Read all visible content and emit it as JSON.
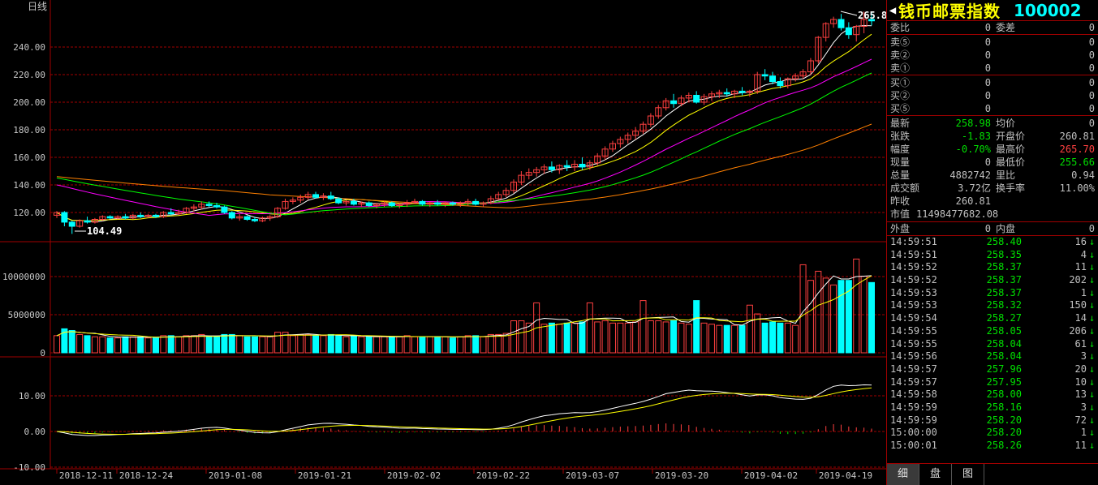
{
  "period_label": "日线",
  "price_axis": [
    "240.00",
    "220.00",
    "200.00",
    "180.00",
    "160.00",
    "140.00",
    "120.00"
  ],
  "volume_axis": [
    "10000000",
    "5000000",
    "0"
  ],
  "macd_axis": [
    "10.00",
    "0.00",
    "-10.00"
  ],
  "dates": [
    "2018-12-11",
    "2018-12-24",
    "2019-01-08",
    "2019-01-21",
    "2019-02-02",
    "2019-02-22",
    "2019-03-07",
    "2019-03-20",
    "2019-04-02",
    "2019-04-19"
  ],
  "high_marker": "265.8",
  "low_marker": "104.49",
  "colors": {
    "up": "#ff4040",
    "down": "#00ffff",
    "grid": "#a00000",
    "ma5": "#ffffff",
    "ma10": "#ffff00",
    "ma20": "#ff00ff",
    "ma30": "#00ff00",
    "ma60": "#ff8000"
  },
  "header": {
    "name": "钱币邮票指数",
    "code": "100002"
  },
  "orderbook": {
    "weibi_label": "委比",
    "weibi": "0",
    "weicha_label": "委差",
    "weicha": "0",
    "asks": [
      {
        "label": "卖⑤",
        "price": "0",
        "vol": "0"
      },
      {
        "label": "卖②",
        "price": "0",
        "vol": "0"
      },
      {
        "label": "卖①",
        "price": "0",
        "vol": "0"
      }
    ],
    "bids": [
      {
        "label": "买①",
        "price": "0",
        "vol": "0"
      },
      {
        "label": "买②",
        "price": "0",
        "vol": "0"
      },
      {
        "label": "买⑤",
        "price": "0",
        "vol": "0"
      }
    ]
  },
  "stats": {
    "latest_label": "最新",
    "latest": "258.98",
    "avg_label": "均价",
    "avg": "0",
    "change_label": "张跌",
    "change": "-1.83",
    "open_label": "开盘价",
    "open": "260.81",
    "amp_label": "幅度",
    "amp": "-0.70%",
    "high_label": "最高价",
    "high": "265.70",
    "cur_label": "现量",
    "cur": "0",
    "low_label": "最低价",
    "low": "255.66",
    "total_label": "总量",
    "total": "4882742",
    "lb_label": "里比",
    "lb": "0.94",
    "amount_label": "成交额",
    "amount": "3.72亿",
    "turnover_label": "换手率",
    "turnover": "11.00%",
    "prev_label": "昨收",
    "prev": "260.81",
    "mcap_label": "市值",
    "mcap": "11498477682.08",
    "outer_label": "外盘",
    "outer": "0",
    "inner_label": "内盘",
    "inner": "0"
  },
  "ticks": [
    {
      "time": "14:59:51",
      "price": "258.40",
      "vol": "16"
    },
    {
      "time": "14:59:51",
      "price": "258.35",
      "vol": "4"
    },
    {
      "time": "14:59:52",
      "price": "258.37",
      "vol": "11"
    },
    {
      "time": "14:59:52",
      "price": "258.37",
      "vol": "202"
    },
    {
      "time": "14:59:53",
      "price": "258.37",
      "vol": "1"
    },
    {
      "time": "14:59:53",
      "price": "258.32",
      "vol": "150"
    },
    {
      "time": "14:59:54",
      "price": "258.27",
      "vol": "14"
    },
    {
      "time": "14:59:55",
      "price": "258.05",
      "vol": "206"
    },
    {
      "time": "14:59:55",
      "price": "258.04",
      "vol": "61"
    },
    {
      "time": "14:59:56",
      "price": "258.04",
      "vol": "3"
    },
    {
      "time": "14:59:57",
      "price": "257.96",
      "vol": "20"
    },
    {
      "time": "14:59:57",
      "price": "257.95",
      "vol": "10"
    },
    {
      "time": "14:59:58",
      "price": "258.00",
      "vol": "13"
    },
    {
      "time": "14:59:59",
      "price": "258.16",
      "vol": "3"
    },
    {
      "time": "14:59:59",
      "price": "258.20",
      "vol": "72"
    },
    {
      "time": "15:00:00",
      "price": "258.20",
      "vol": "1"
    },
    {
      "time": "15:00:01",
      "price": "258.26",
      "vol": "11"
    }
  ],
  "tabs": [
    "细",
    "盘",
    "图"
  ],
  "chart_data": {
    "type": "candlestick",
    "price_range": [
      104,
      268
    ],
    "candles": [
      [
        118,
        121,
        116,
        120
      ],
      [
        120,
        121,
        110,
        113
      ],
      [
        113,
        114,
        104.49,
        110
      ],
      [
        110,
        115,
        109,
        114
      ],
      [
        114,
        117,
        112,
        113
      ],
      [
        113,
        116,
        112,
        115
      ],
      [
        115,
        118,
        114,
        117
      ],
      [
        117,
        118,
        115,
        116
      ],
      [
        116,
        118,
        115,
        117
      ],
      [
        117,
        119,
        115,
        116
      ],
      [
        116,
        119,
        115,
        118
      ],
      [
        118,
        120,
        116,
        117
      ],
      [
        117,
        119,
        116,
        118
      ],
      [
        118,
        119,
        116,
        117
      ],
      [
        117,
        121,
        116,
        120
      ],
      [
        120,
        123,
        118,
        119
      ],
      [
        119,
        122,
        118,
        120
      ],
      [
        120,
        124,
        119,
        123
      ],
      [
        123,
        126,
        121,
        124
      ],
      [
        124,
        128,
        122,
        126
      ],
      [
        126,
        128,
        124,
        125
      ],
      [
        125,
        127,
        123,
        124
      ],
      [
        124,
        125,
        119,
        120
      ],
      [
        120,
        121,
        115,
        116
      ],
      [
        116,
        119,
        114,
        117
      ],
      [
        117,
        118,
        114,
        115
      ],
      [
        115,
        117,
        113,
        114
      ],
      [
        114,
        117,
        113,
        116
      ],
      [
        116,
        118,
        114,
        117
      ],
      [
        117,
        124,
        116,
        123
      ],
      [
        123,
        130,
        122,
        128
      ],
      [
        128,
        131,
        126,
        129
      ],
      [
        129,
        133,
        127,
        131
      ],
      [
        131,
        135,
        129,
        133
      ],
      [
        133,
        135,
        130,
        131
      ],
      [
        131,
        134,
        129,
        132
      ],
      [
        132,
        135,
        129,
        130
      ],
      [
        130,
        131,
        126,
        127
      ],
      [
        127,
        129,
        125,
        128
      ],
      [
        128,
        130,
        125,
        126
      ],
      [
        126,
        128,
        124,
        127
      ],
      [
        127,
        128,
        124,
        125
      ],
      [
        125,
        127,
        123,
        126
      ],
      [
        126,
        128,
        124,
        127
      ],
      [
        127,
        128,
        124,
        125
      ],
      [
        125,
        127,
        123,
        126
      ],
      [
        126,
        129,
        124,
        127
      ],
      [
        127,
        130,
        126,
        128
      ],
      [
        128,
        129,
        125,
        126
      ],
      [
        126,
        128,
        124,
        127
      ],
      [
        127,
        129,
        125,
        126
      ],
      [
        126,
        128,
        124,
        127
      ],
      [
        127,
        128,
        125,
        126
      ],
      [
        126,
        128,
        124,
        127
      ],
      [
        127,
        130,
        125,
        128
      ],
      [
        128,
        130,
        125,
        126
      ],
      [
        126,
        128,
        124,
        127
      ],
      [
        127,
        132,
        126,
        130
      ],
      [
        130,
        135,
        129,
        133
      ],
      [
        133,
        138,
        131,
        136
      ],
      [
        136,
        144,
        134,
        142
      ],
      [
        142,
        150,
        140,
        147
      ],
      [
        147,
        152,
        144,
        149
      ],
      [
        149,
        153,
        146,
        151
      ],
      [
        151,
        155,
        148,
        153
      ],
      [
        153,
        157,
        149,
        151
      ],
      [
        151,
        155,
        148,
        154
      ],
      [
        154,
        158,
        150,
        153
      ],
      [
        153,
        158,
        150,
        155
      ],
      [
        155,
        160,
        151,
        153
      ],
      [
        153,
        158,
        151,
        156
      ],
      [
        156,
        163,
        154,
        161
      ],
      [
        161,
        168,
        158,
        166
      ],
      [
        166,
        172,
        164,
        170
      ],
      [
        170,
        175,
        167,
        173
      ],
      [
        173,
        178,
        170,
        176
      ],
      [
        176,
        182,
        173,
        179
      ],
      [
        179,
        186,
        177,
        184
      ],
      [
        184,
        192,
        182,
        190
      ],
      [
        190,
        198,
        188,
        196
      ],
      [
        196,
        203,
        194,
        201
      ],
      [
        201,
        206,
        196,
        199
      ],
      [
        199,
        205,
        197,
        203
      ],
      [
        203,
        207,
        200,
        205
      ],
      [
        205,
        208,
        199,
        200
      ],
      [
        200,
        206,
        198,
        204
      ],
      [
        204,
        208,
        201,
        206
      ],
      [
        206,
        209,
        203,
        207
      ],
      [
        207,
        210,
        204,
        206
      ],
      [
        206,
        209,
        203,
        208
      ],
      [
        208,
        211,
        205,
        207
      ],
      [
        207,
        209,
        204,
        208
      ],
      [
        208,
        222,
        206,
        220
      ],
      [
        220,
        224,
        216,
        219
      ],
      [
        219,
        222,
        213,
        215
      ],
      [
        215,
        218,
        210,
        212
      ],
      [
        212,
        218,
        210,
        217
      ],
      [
        217,
        221,
        215,
        219
      ],
      [
        219,
        224,
        217,
        222
      ],
      [
        222,
        232,
        220,
        230
      ],
      [
        230,
        248,
        228,
        247
      ],
      [
        247,
        258,
        244,
        257
      ],
      [
        257,
        262,
        254,
        260
      ],
      [
        260,
        264,
        252,
        254
      ],
      [
        254,
        258,
        246,
        249
      ],
      [
        249,
        256,
        244,
        255
      ],
      [
        255,
        265.7,
        250,
        260
      ],
      [
        260,
        265.8,
        255.66,
        258.98
      ]
    ]
  }
}
